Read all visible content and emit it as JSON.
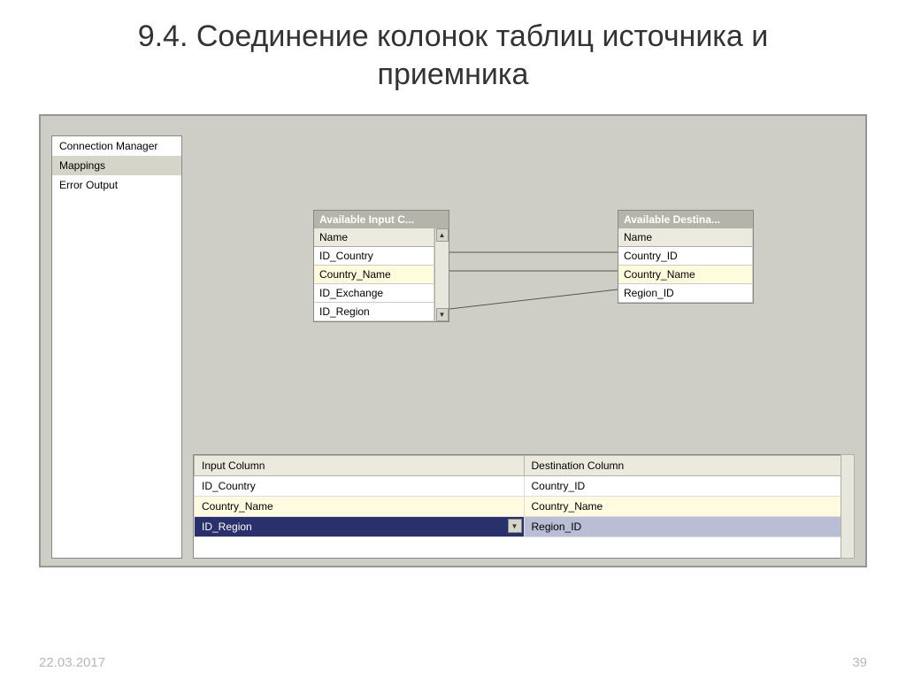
{
  "slide": {
    "title": "9.4. Соединение колонок таблиц источника и приемника",
    "date": "22.03.2017",
    "page": "39"
  },
  "sidebar": {
    "items": [
      {
        "label": "Connection Manager",
        "selected": false
      },
      {
        "label": "Mappings",
        "selected": true
      },
      {
        "label": "Error Output",
        "selected": false
      }
    ]
  },
  "input_box": {
    "title": "Available Input C...",
    "header": "Name",
    "rows": [
      {
        "label": "ID_Country",
        "hl": false
      },
      {
        "label": "Country_Name",
        "hl": true
      },
      {
        "label": "ID_Exchange",
        "hl": false
      },
      {
        "label": "ID_Region",
        "hl": false
      }
    ]
  },
  "dest_box": {
    "title": "Available Destina...",
    "header": "Name",
    "rows": [
      {
        "label": "Country_ID",
        "hl": false
      },
      {
        "label": "Country_Name",
        "hl": true
      },
      {
        "label": "Region_ID",
        "hl": false
      }
    ]
  },
  "grid": {
    "col1": "Input Column",
    "col2": "Destination Column",
    "rows": [
      {
        "input": "ID_Country",
        "dest": "Country_ID",
        "sel": false,
        "alt": false
      },
      {
        "input": "Country_Name",
        "dest": "Country_Name",
        "sel": false,
        "alt": true
      },
      {
        "input": "ID_Region",
        "dest": "Region_ID",
        "sel": true,
        "alt": false
      }
    ]
  }
}
